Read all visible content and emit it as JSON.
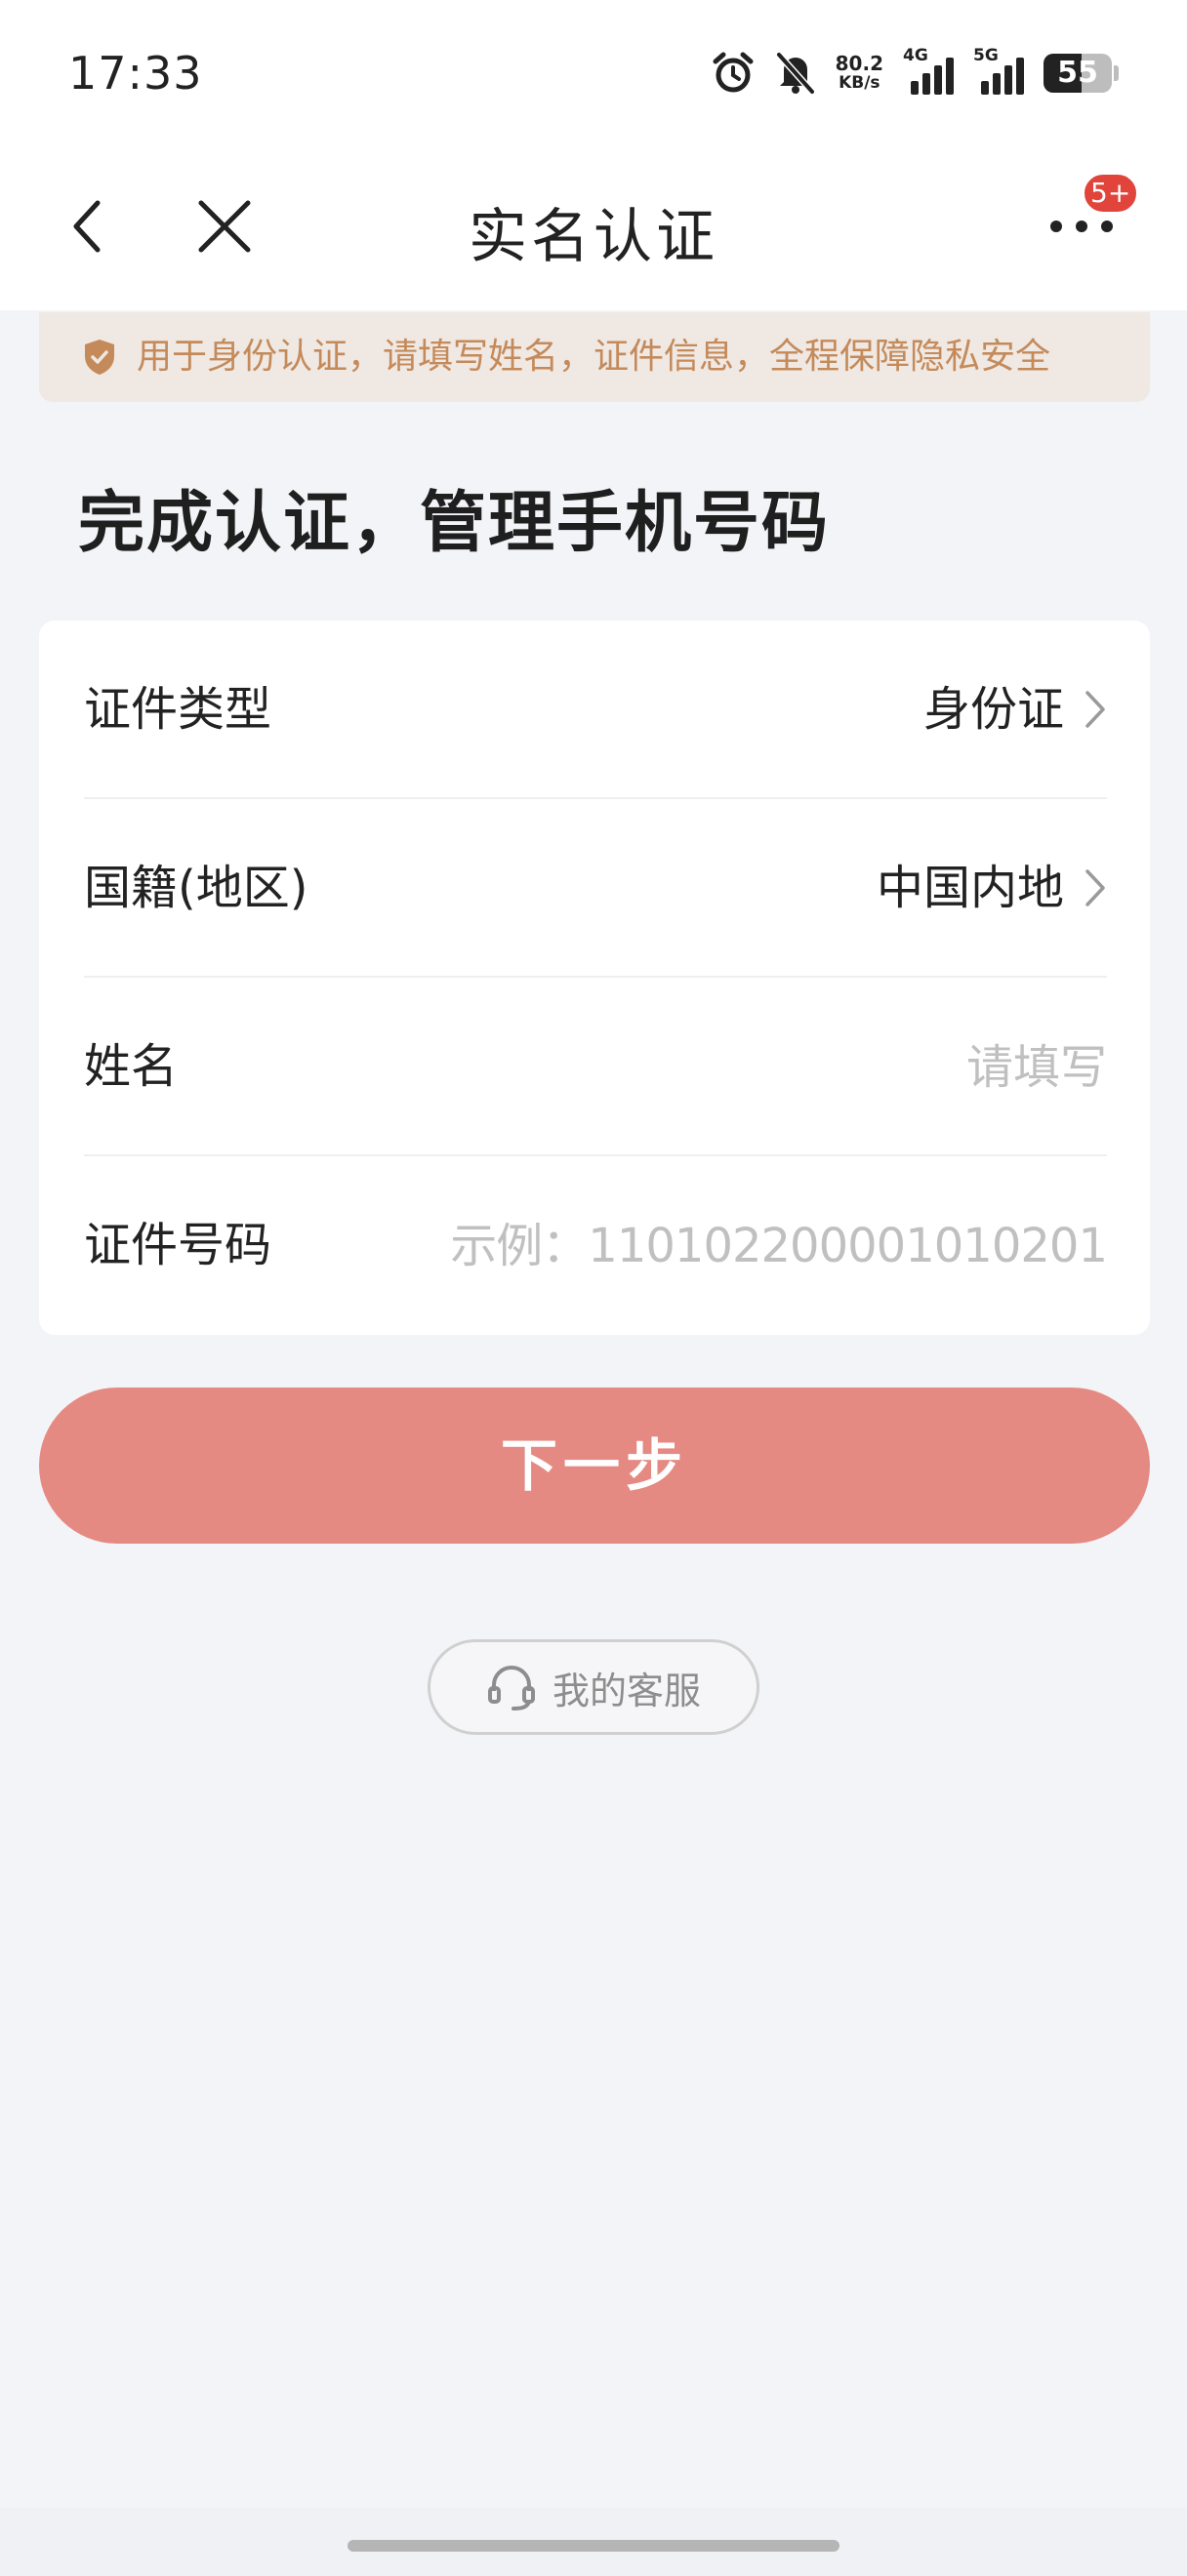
{
  "status_bar": {
    "time": "17:33",
    "net_speed_value": "80.2",
    "net_speed_unit": "KB/s",
    "signal_1_type": "4G",
    "signal_2_type": "5G",
    "battery_level": "55",
    "icons": [
      "alarm-icon",
      "bell-muted-icon",
      "signal-4g-icon",
      "signal-5g-icon",
      "battery-icon"
    ]
  },
  "nav": {
    "title": "实名认证",
    "badge": "5+",
    "icons": [
      "back-icon",
      "close-icon",
      "more-icon"
    ]
  },
  "notice": {
    "text": "用于身份认证，请填写姓名，证件信息，全程保障隐私安全",
    "icon": "shield-icon",
    "color": "#c48a5a"
  },
  "heading": "完成认证，管理手机号码",
  "form": {
    "id_type_label": "证件类型",
    "id_type_value": "身份证",
    "nationality_label": "国籍(地区)",
    "nationality_value": "中国内地",
    "name_label": "姓名",
    "name_placeholder": "请填写",
    "id_number_label": "证件号码",
    "id_number_placeholder": "示例：110102200001010201"
  },
  "next_button": {
    "label": "下一步",
    "color": "#e58a83"
  },
  "service_button": {
    "label": "我的客服",
    "icon": "headset-icon"
  }
}
